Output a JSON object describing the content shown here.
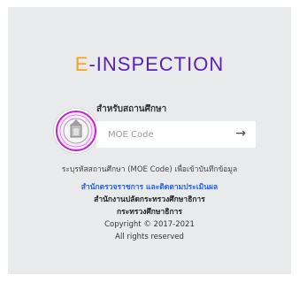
{
  "header": {
    "title_prefix": "E",
    "title_rest": "-INSPECTION",
    "title_colors": {
      "prefix": "#f3a51d",
      "rest": "#5b21b6"
    }
  },
  "login": {
    "subtitle": "สำหรับสถานศึกษา",
    "code_placeholder": "MOE Code",
    "submit_icon": "arrow-right-icon",
    "hint": "ระบุรหัสสถานศึกษา (MOE Code) เพื่อเข้าบันทึกข้อมูล"
  },
  "footer": {
    "office_link": "สำนักตรวจราชการ และติดตามประเมินผล",
    "line2": "สำนักงานปลัดกระทรวงศึกษาธิการ",
    "line3": "กระทรวงศึกษาธิการ",
    "copyright": "Copyright © 2017-2021",
    "rights": "All rights reserved"
  }
}
